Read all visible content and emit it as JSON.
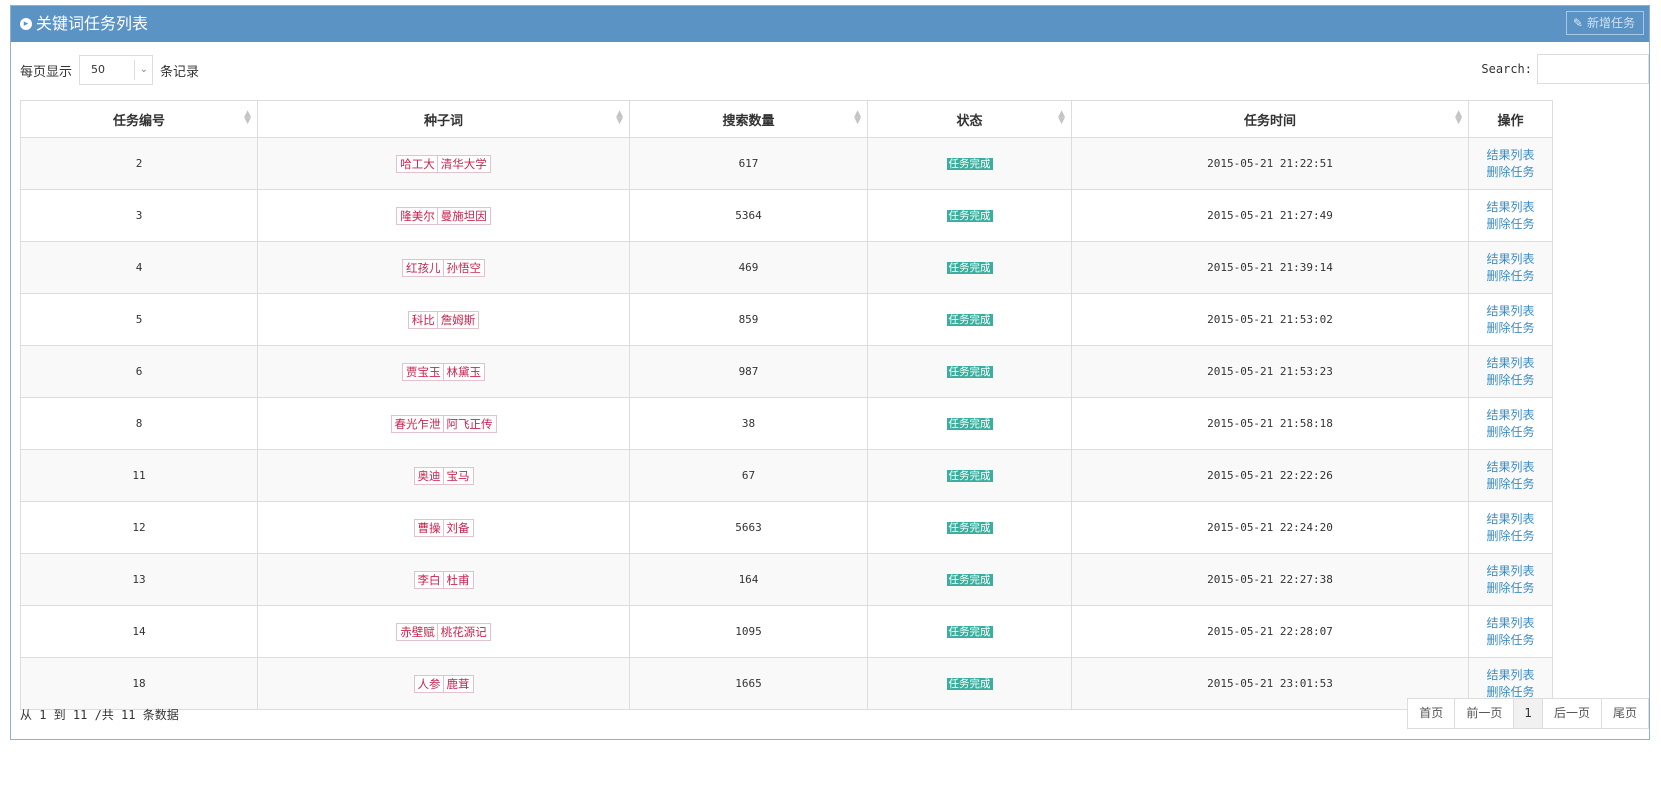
{
  "header": {
    "title": "关键词任务列表",
    "add_button_label": "新增任务"
  },
  "length": {
    "prefix": "每页显示",
    "value": "50",
    "suffix": "条记录"
  },
  "search": {
    "label": "Search:",
    "value": ""
  },
  "table": {
    "columns": [
      "任务编号",
      "种子词",
      "搜索数量",
      "状态",
      "任务时间",
      "操作"
    ],
    "rows": [
      {
        "id": "2",
        "seeds": [
          "哈工大",
          "清华大学"
        ],
        "count": "617",
        "status": "任务完成",
        "time": "2015-05-21 21:22:51",
        "actions": [
          "结果列表",
          "删除任务"
        ]
      },
      {
        "id": "3",
        "seeds": [
          "隆美尔",
          "曼施坦因"
        ],
        "count": "5364",
        "status": "任务完成",
        "time": "2015-05-21 21:27:49",
        "actions": [
          "结果列表",
          "删除任务"
        ]
      },
      {
        "id": "4",
        "seeds": [
          "红孩儿",
          "孙悟空"
        ],
        "count": "469",
        "status": "任务完成",
        "time": "2015-05-21 21:39:14",
        "actions": [
          "结果列表",
          "删除任务"
        ]
      },
      {
        "id": "5",
        "seeds": [
          "科比",
          "詹姆斯"
        ],
        "count": "859",
        "status": "任务完成",
        "time": "2015-05-21 21:53:02",
        "actions": [
          "结果列表",
          "删除任务"
        ]
      },
      {
        "id": "6",
        "seeds": [
          "贾宝玉",
          "林黛玉"
        ],
        "count": "987",
        "status": "任务完成",
        "time": "2015-05-21 21:53:23",
        "actions": [
          "结果列表",
          "删除任务"
        ]
      },
      {
        "id": "8",
        "seeds": [
          "春光乍泄",
          "阿飞正传"
        ],
        "count": "38",
        "status": "任务完成",
        "time": "2015-05-21 21:58:18",
        "actions": [
          "结果列表",
          "删除任务"
        ]
      },
      {
        "id": "11",
        "seeds": [
          "奥迪",
          "宝马"
        ],
        "count": "67",
        "status": "任务完成",
        "time": "2015-05-21 22:22:26",
        "actions": [
          "结果列表",
          "删除任务"
        ]
      },
      {
        "id": "12",
        "seeds": [
          "曹操",
          "刘备"
        ],
        "count": "5663",
        "status": "任务完成",
        "time": "2015-05-21 22:24:20",
        "actions": [
          "结果列表",
          "删除任务"
        ]
      },
      {
        "id": "13",
        "seeds": [
          "李白",
          "杜甫"
        ],
        "count": "164",
        "status": "任务完成",
        "time": "2015-05-21 22:27:38",
        "actions": [
          "结果列表",
          "删除任务"
        ]
      },
      {
        "id": "14",
        "seeds": [
          "赤壁赋",
          "桃花源记"
        ],
        "count": "1095",
        "status": "任务完成",
        "time": "2015-05-21 22:28:07",
        "actions": [
          "结果列表",
          "删除任务"
        ]
      },
      {
        "id": "18",
        "seeds": [
          "人参",
          "鹿茸"
        ],
        "count": "1665",
        "status": "任务完成",
        "time": "2015-05-21 23:01:53",
        "actions": [
          "结果列表",
          "删除任务"
        ]
      }
    ]
  },
  "info": "从 1 到 11 /共 11 条数据",
  "pagination": {
    "first": "首页",
    "prev": "前一页",
    "current": "1",
    "next": "后一页",
    "last": "尾页"
  },
  "colors": {
    "header_bg": "#5b93c5",
    "tag_text": "#c7254e",
    "status_bg": "#3aaf9f",
    "link": "#3c8dc4"
  },
  "icons": {
    "title": "circle-arrow-icon",
    "add": "pencil-icon",
    "select": "chevron-down-icon",
    "sort": "sort-icon"
  }
}
